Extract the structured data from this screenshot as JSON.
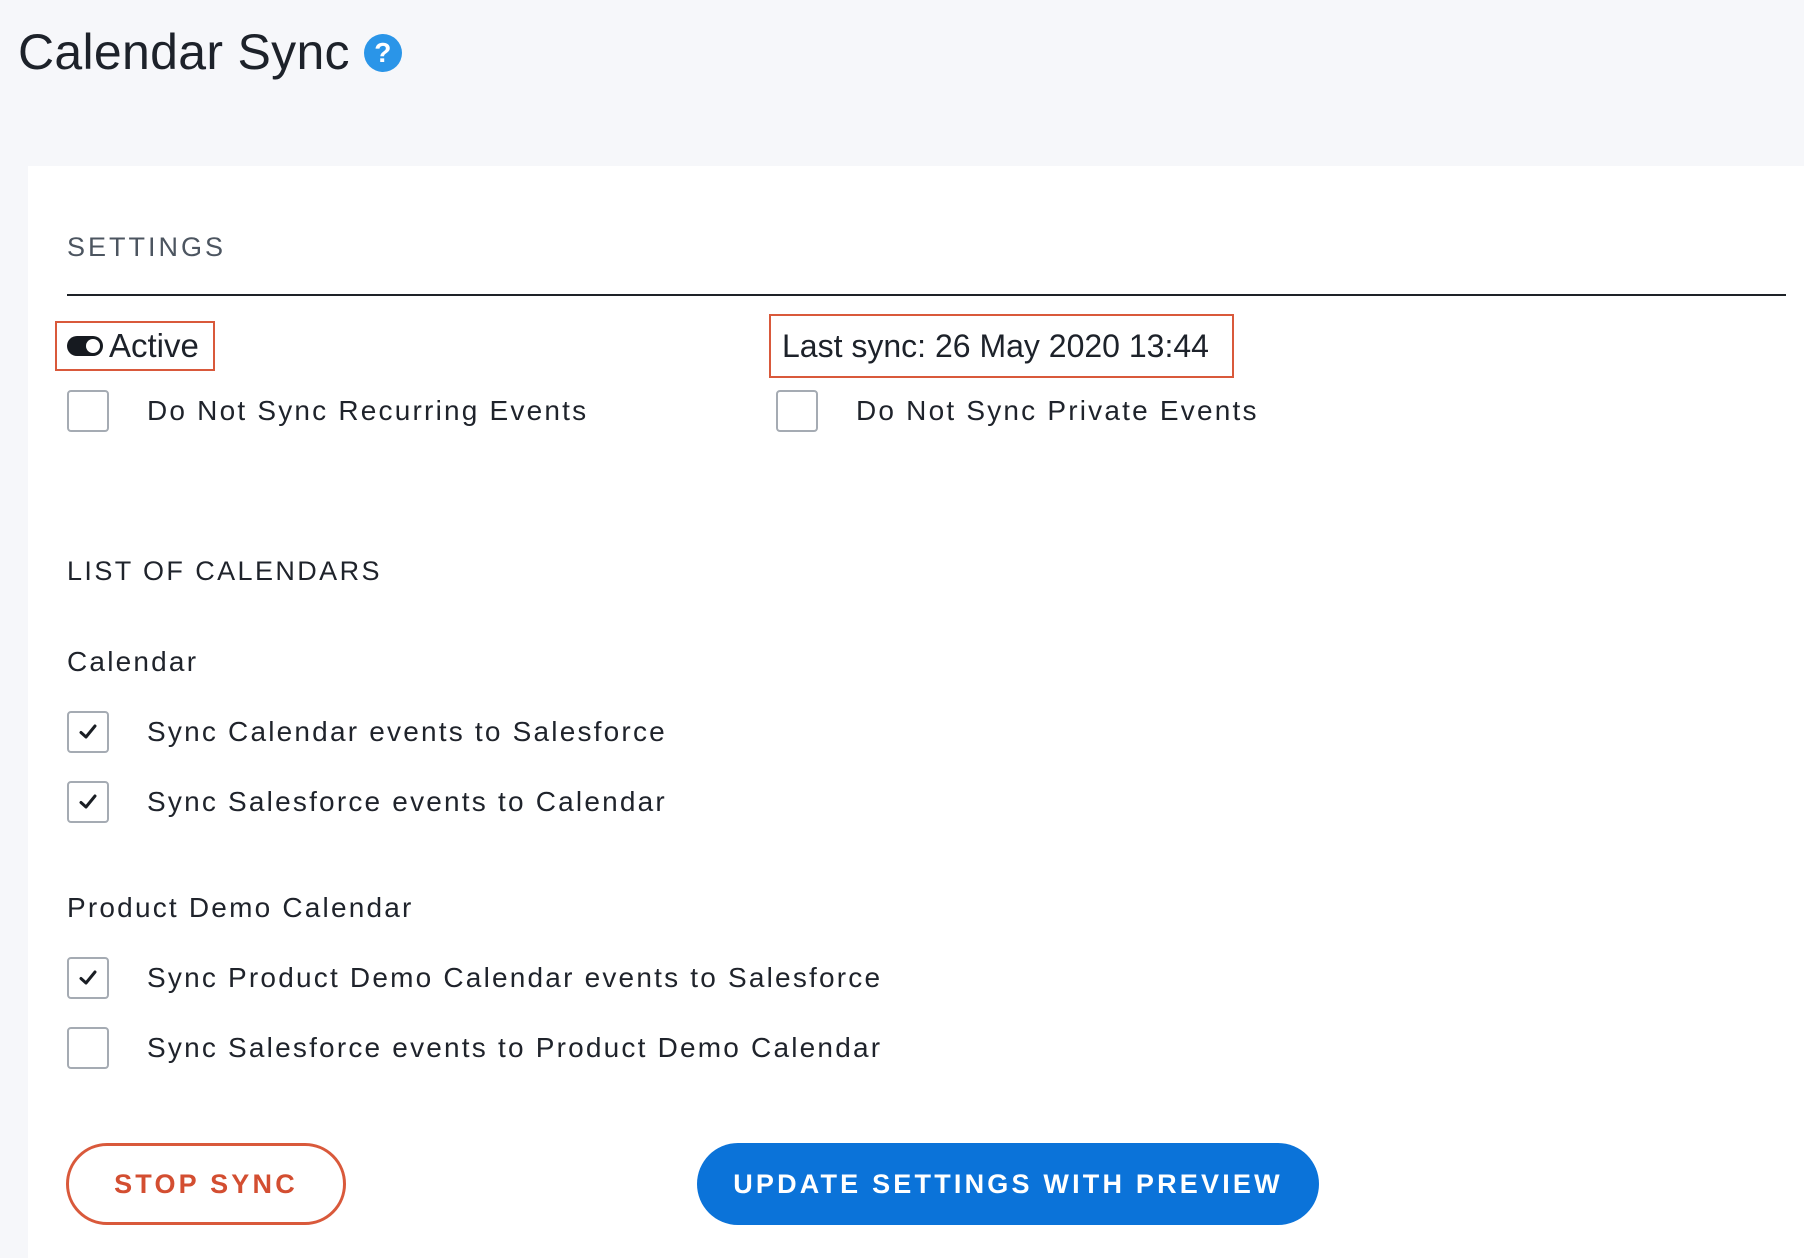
{
  "header": {
    "title": "Calendar Sync",
    "help_icon": "?"
  },
  "settings": {
    "section_title": "SETTINGS",
    "status_label": "Active",
    "toggle_state": "on",
    "last_sync": "Last sync: 26 May 2020 13:44",
    "options": [
      {
        "label": "Do Not Sync Recurring Events",
        "checked": false
      },
      {
        "label": "Do Not Sync Private Events",
        "checked": false
      }
    ]
  },
  "calendars": {
    "section_title": "LIST OF CALENDARS",
    "items": [
      {
        "name": "Calendar",
        "options": [
          {
            "label": "Sync Calendar events to Salesforce",
            "checked": true
          },
          {
            "label": "Sync Salesforce events to Calendar",
            "checked": true
          }
        ]
      },
      {
        "name": "Product Demo Calendar",
        "options": [
          {
            "label": "Sync Product Demo Calendar events to Salesforce",
            "checked": true
          },
          {
            "label": "Sync Salesforce events to Product Demo Calendar",
            "checked": false
          }
        ]
      }
    ]
  },
  "actions": {
    "stop_label": "STOP SYNC",
    "update_label": "UPDATE SETTINGS WITH PREVIEW"
  },
  "colors": {
    "accent_blue": "#0b73d9",
    "help_blue": "#2a95e8",
    "highlight_red": "#d9593b",
    "stop_text": "#d34e31"
  }
}
